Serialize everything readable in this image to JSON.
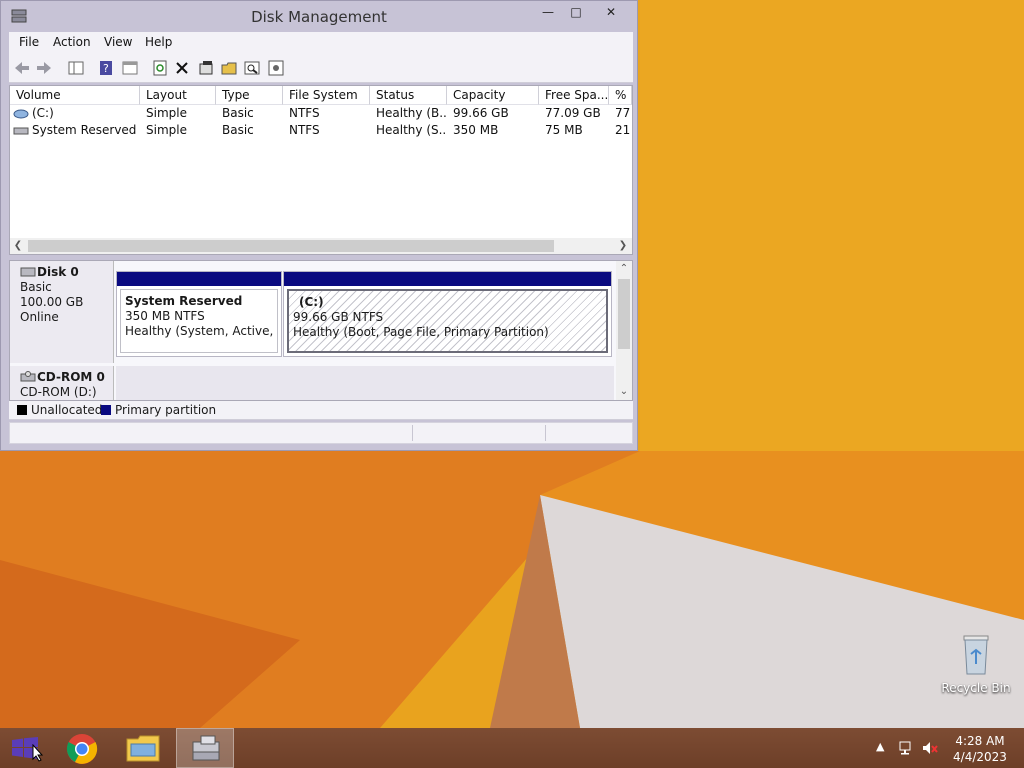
{
  "window": {
    "title": "Disk Management",
    "controls": {
      "minimize": "—",
      "maximize": "□",
      "close": "✕"
    }
  },
  "menu": [
    "File",
    "Action",
    "View",
    "Help"
  ],
  "toolbar_icons": [
    "back-icon",
    "forward-icon",
    "console-tree-icon",
    "help-icon",
    "properties-icon",
    "refresh-icon",
    "delete-icon",
    "new-icon",
    "open-icon",
    "search-icon",
    "settings-icon"
  ],
  "volume_list": {
    "columns": [
      "Volume",
      "Layout",
      "Type",
      "File System",
      "Status",
      "Capacity",
      "Free Spa...",
      "% F"
    ],
    "rows": [
      {
        "volume": "(C:)",
        "layout": "Simple",
        "type": "Basic",
        "fs": "NTFS",
        "status": "Healthy (B...",
        "capacity": "99.66 GB",
        "free": "77.09 GB",
        "pct": "77"
      },
      {
        "volume": "System Reserved",
        "layout": "Simple",
        "type": "Basic",
        "fs": "NTFS",
        "status": "Healthy (S...",
        "capacity": "350 MB",
        "free": "75 MB",
        "pct": "21"
      }
    ]
  },
  "disks": {
    "disk0": {
      "name": "Disk 0",
      "type": "Basic",
      "size": "100.00 GB",
      "state": "Online"
    },
    "cdrom0": {
      "name": "CD-ROM 0",
      "drive": "CD-ROM (D:)"
    }
  },
  "partitions": {
    "sysres": {
      "name": "System Reserved",
      "size": "350 MB NTFS",
      "status": "Healthy (System, Active, Prin"
    },
    "c": {
      "name": "(C:)",
      "size": "99.66 GB NTFS",
      "status": "Healthy (Boot, Page File, Primary Partition)"
    }
  },
  "legend": {
    "unallocated": "Unallocated",
    "primary": "Primary partition",
    "unallocated_color": "#000000",
    "primary_color": "#0a0a80"
  },
  "desktop": {
    "recycle_bin": "Recycle Bin"
  },
  "taskbar": {
    "time": "4:28 AM",
    "date": "4/4/2023",
    "tray_arrow": "▲"
  }
}
